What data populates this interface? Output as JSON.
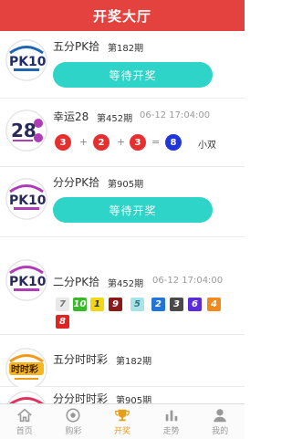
{
  "header": {
    "title": "开奖大厅"
  },
  "colors": {
    "header": "#e3423f",
    "wait_button": "#2ed4c7",
    "active_tab": "#e5a019"
  },
  "rows": [
    {
      "logo": "PK10",
      "name": "五分PK拾",
      "issue": "第182期",
      "button": "等待开奖"
    },
    {
      "logo": "28",
      "name": "幸运28",
      "issue": "第452期",
      "time": "06-12 17:04:00",
      "balls": [
        "3",
        "2",
        "3"
      ],
      "ops": [
        "+",
        "+",
        "="
      ],
      "sum": "8",
      "result": "小双"
    },
    {
      "logo": "PK10",
      "name": "分分PK拾",
      "issue": "第905期",
      "button": "等待开奖"
    },
    {
      "logo": "PK10",
      "name": "二分PK拾",
      "issue": "第452期",
      "time": "06-12 17:04:00",
      "numbers": [
        "7",
        "10",
        "1",
        "9",
        "5",
        "2",
        "3",
        "6",
        "4",
        "8"
      ]
    },
    {
      "logo": "时时彩",
      "name": "五分时时彩",
      "issue": "第182期"
    },
    {
      "logo": "时时彩",
      "name": "分分时时彩",
      "issue": "第905期"
    }
  ],
  "tabbar": [
    {
      "label": "首页",
      "icon": "home-icon"
    },
    {
      "label": "购彩",
      "icon": "lottery-ball-icon"
    },
    {
      "label": "开奖",
      "icon": "trophy-icon",
      "active": true
    },
    {
      "label": "走势",
      "icon": "bar-chart-icon"
    },
    {
      "label": "我的",
      "icon": "user-icon"
    }
  ]
}
